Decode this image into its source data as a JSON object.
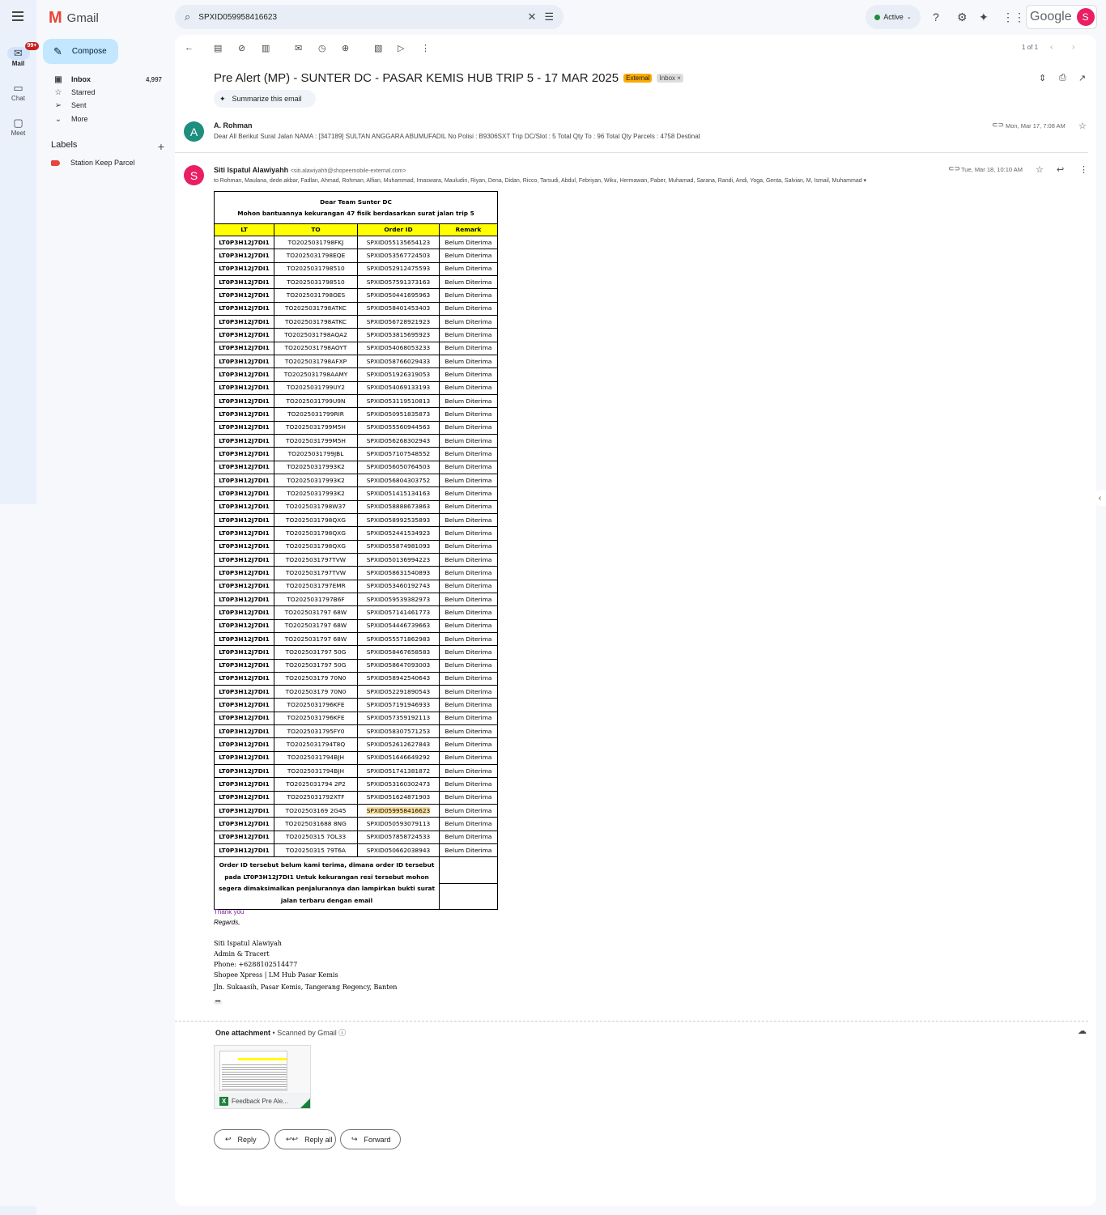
{
  "app": {
    "name": "Gmail",
    "google": "Google",
    "account_initial": "S"
  },
  "search": {
    "query": "SPXID059958416623"
  },
  "status": {
    "label": "Active"
  },
  "rail": {
    "mail": "Mail",
    "chat": "Chat",
    "meet": "Meet",
    "badge": "99+"
  },
  "compose": "Compose",
  "nav": {
    "inbox": "Inbox",
    "inbox_count": "4,997",
    "starred": "Starred",
    "sent": "Sent",
    "more": "More",
    "labels_title": "Labels",
    "label_station": "Station Keep Parcel"
  },
  "pager": "1 of 1",
  "email": {
    "subject": "Pre Alert (MP) - SUNTER DC - PASAR KEMIS HUB TRIP 5 - 17 MAR 2025",
    "chip_external": "External",
    "chip_inbox": "Inbox ×",
    "summarize": "Summarize this email"
  },
  "msg1": {
    "initial": "A",
    "sender": "A. Rohman",
    "date": "Mon, Mar 17, 7:08 AM",
    "snippet": "Dear All Berikut Surat Jalan NAMA : [347189] SULTAN ANGGARA ABUMUFADIL No Polisi : B9306SXT Trip DC/Slot : 5 Total Qty To : 96 Total Qty Parcels : 4758 Destinat"
  },
  "msg2": {
    "initial": "S",
    "sender": "Siti Ispatul Alawiyahh",
    "email": "<siti.alawiyahh@shopeemobile-external.com>",
    "date": "Tue, Mar 18, 10:10 AM",
    "to": "to Rohman, Maulana, dede.akbar, Fadlan, Ahmad, Rohman, Alfian, Muhammad, Imaswara, Mauludin, Riyan, Dena, Didan, Ricco, Tarsudi, Abdul, Febriyan, Wiku, Hermawan, Paber, Muhamad, Sarana, Randi, Andi, Yoga, Genta, Salvian, M, Ismail, Muhammad ▾"
  },
  "table": {
    "title1": "Dear Team Sunter DC",
    "title2": "Mohon bantuannya kekurangan 47  fisik berdasarkan surat jalan trip 5",
    "headers": [
      "LT",
      "TO",
      "Order ID",
      "Remark"
    ],
    "highlight_index": 43,
    "rows": [
      [
        "LT0P3H12J7DI1",
        "TO2025031798FKJ",
        "SPXID055135654123",
        "Belum Diterima"
      ],
      [
        "LT0P3H12J7DI1",
        "TO2025031798EQE",
        "SPXID053567724503",
        "Belum Diterima"
      ],
      [
        "LT0P3H12J7DI1",
        "TO2025031798510",
        "SPXID052912475593",
        "Belum Diterima"
      ],
      [
        "LT0P3H12J7DI1",
        "TO2025031798510",
        "SPXID057591373163",
        "Belum Diterima"
      ],
      [
        "LT0P3H12J7DI1",
        "TO2025031798OES",
        "SPXID050441695963",
        "Belum Diterima"
      ],
      [
        "LT0P3H12J7DI1",
        "TO2025031798ATKC",
        "SPXID058401453403",
        "Belum Diterima"
      ],
      [
        "LT0P3H12J7DI1",
        "TO2025031798ATKC",
        "SPXID056728921923",
        "Belum Diterima"
      ],
      [
        "LT0P3H12J7DI1",
        "TO2025031798AQA2",
        "SPXID053815695923",
        "Belum Diterima"
      ],
      [
        "LT0P3H12J7DI1",
        "TO2025031798AOYT",
        "SPXID054068053233",
        "Belum Diterima"
      ],
      [
        "LT0P3H12J7DI1",
        "TO2025031798AFXP",
        "SPXID058766029433",
        "Belum Diterima"
      ],
      [
        "LT0P3H12J7DI1",
        "TO2025031798AAMY",
        "SPXID051926319053",
        "Belum Diterima"
      ],
      [
        "LT0P3H12J7DI1",
        "TO2025031799UY2",
        "SPXID054069133193",
        "Belum Diterima"
      ],
      [
        "LT0P3H12J7DI1",
        "TO2025031799U9N",
        "SPXID053119510813",
        "Belum Diterima"
      ],
      [
        "LT0P3H12J7DI1",
        "TO2025031799RIR",
        "SPXID050951835873",
        "Belum Diterima"
      ],
      [
        "LT0P3H12J7DI1",
        "TO2025031799M5H",
        "SPXID055560944563",
        "Belum Diterima"
      ],
      [
        "LT0P3H12J7DI1",
        "TO2025031799M5H",
        "SPXID056268302943",
        "Belum Diterima"
      ],
      [
        "LT0P3H12J7DI1",
        "TO2025031799JBL",
        "SPXID057107548552",
        "Belum Diterima"
      ],
      [
        "LT0P3H12J7DI1",
        "TO20250317993K2",
        "SPXID056050764503",
        "Belum Diterima"
      ],
      [
        "LT0P3H12J7DI1",
        "TO20250317993K2",
        "SPXID056804303752",
        "Belum Diterima"
      ],
      [
        "LT0P3H12J7DI1",
        "TO20250317993K2",
        "SPXID051415134163",
        "Belum Diterima"
      ],
      [
        "LT0P3H12J7DI1",
        "TO2025031798W37",
        "SPXID058888673863",
        "Belum Diterima"
      ],
      [
        "LT0P3H12J7DI1",
        "TO2025031798QXG",
        "SPXID058992535893",
        "Belum Diterima"
      ],
      [
        "LT0P3H12J7DI1",
        "TO2025031798QXG",
        "SPXID052441534923",
        "Belum Diterima"
      ],
      [
        "LT0P3H12J7DI1",
        "TO2025031798QXG",
        "SPXID055874981093",
        "Belum Diterima"
      ],
      [
        "LT0P3H12J7DI1",
        "TO2025031797TVW",
        "SPXID050136994223",
        "Belum Diterima"
      ],
      [
        "LT0P3H12J7DI1",
        "TO2025031797TVW",
        "SPXID058631540893",
        "Belum Diterima"
      ],
      [
        "LT0P3H12J7DI1",
        "TO2025031797EMR",
        "SPXID053460192743",
        "Belum Diterima"
      ],
      [
        "LT0P3H12J7DI1",
        "TO2025031797B6F",
        "SPXID059539382973",
        "Belum Diterima"
      ],
      [
        "LT0P3H12J7DI1",
        "TO2025031797 68W",
        "SPXID057141461773",
        "Belum Diterima"
      ],
      [
        "LT0P3H12J7DI1",
        "TO2025031797 68W",
        "SPXID054446739663",
        "Belum Diterima"
      ],
      [
        "LT0P3H12J7DI1",
        "TO2025031797 68W",
        "SPXID055571862983",
        "Belum Diterima"
      ],
      [
        "LT0P3H12J7DI1",
        "TO2025031797 50G",
        "SPXID058467658583",
        "Belum Diterima"
      ],
      [
        "LT0P3H12J7DI1",
        "TO2025031797 50G",
        "SPXID058647093003",
        "Belum Diterima"
      ],
      [
        "LT0P3H12J7DI1",
        "TO202503179 70N0",
        "SPXID058942540643",
        "Belum Diterima"
      ],
      [
        "LT0P3H12J7DI1",
        "TO202503179 70N0",
        "SPXID052291890543",
        "Belum Diterima"
      ],
      [
        "LT0P3H12J7DI1",
        "TO2025031796KFE",
        "SPXID057191946933",
        "Belum Diterima"
      ],
      [
        "LT0P3H12J7DI1",
        "TO2025031796KFE",
        "SPXID057359192113",
        "Belum Diterima"
      ],
      [
        "LT0P3H12J7DI1",
        "TO2025031795FY0",
        "SPXID058307571253",
        "Belum Diterima"
      ],
      [
        "LT0P3H12J7DI1",
        "TO2025031794T8Q",
        "SPXID052612627843",
        "Belum Diterima"
      ],
      [
        "LT0P3H12J7DI1",
        "TO2025031794BJH",
        "SPXID051646649292",
        "Belum Diterima"
      ],
      [
        "LT0P3H12J7DI1",
        "TO2025031794BJH",
        "SPXID051741381872",
        "Belum Diterima"
      ],
      [
        "LT0P3H12J7DI1",
        "TO2025031794 2P2",
        "SPXID053160302473",
        "Belum Diterima"
      ],
      [
        "LT0P3H12J7DI1",
        "TO2025031792XTF",
        "SPXID051624871903",
        "Belum Diterima"
      ],
      [
        "LT0P3H12J7DI1",
        "TO202503169 2G45",
        "SPXID059958416623",
        "Belum Diterima"
      ],
      [
        "LT0P3H12J7DI1",
        "TO2025031688 8NG",
        "SPXID050593079113",
        "Belum Diterima"
      ],
      [
        "LT0P3H12J7DI1",
        "TO20250315 7OL33",
        "SPXID057858724533",
        "Belum Diterima"
      ],
      [
        "LT0P3H12J7DI1",
        "TO20250315 79T6A",
        "SPXID050662038943",
        "Belum Diterima"
      ]
    ],
    "footer": "Order ID tersebut belum kami terima, dimana order ID tersebut pada LT0P3H12J7DI1  Untuk kekurangan resi tersebut mohon segera dimaksimalkan penjalurannya dan lampirkan bukti surat jalan terbaru dengan email"
  },
  "signature": {
    "thanks": "Thank you",
    "regards": "Regards,",
    "name": "Siti Ispatul Alawiyah",
    "role": "Admin & Tracert",
    "phone": "Phone: +6288102514477",
    "company": "Shopee Xpress | LM Hub Pasar Kemis",
    "address": "Jln. Sukaasih, Pasar Kemis, Tangerang Regency, Banten",
    "more": "•••"
  },
  "attachment": {
    "title": "One attachment",
    "scanned": "Scanned by Gmail",
    "filename": "Feedback Pre Ale..."
  },
  "actions": {
    "reply": "Reply",
    "reply_all": "Reply all",
    "forward": "Forward"
  },
  "colors": {
    "compose_bg": "#c2e7ff",
    "external_chip": "#f9ab00",
    "table_header": "#ffff00",
    "highlight": "#fce29f",
    "label_tag": "#e8453c"
  }
}
